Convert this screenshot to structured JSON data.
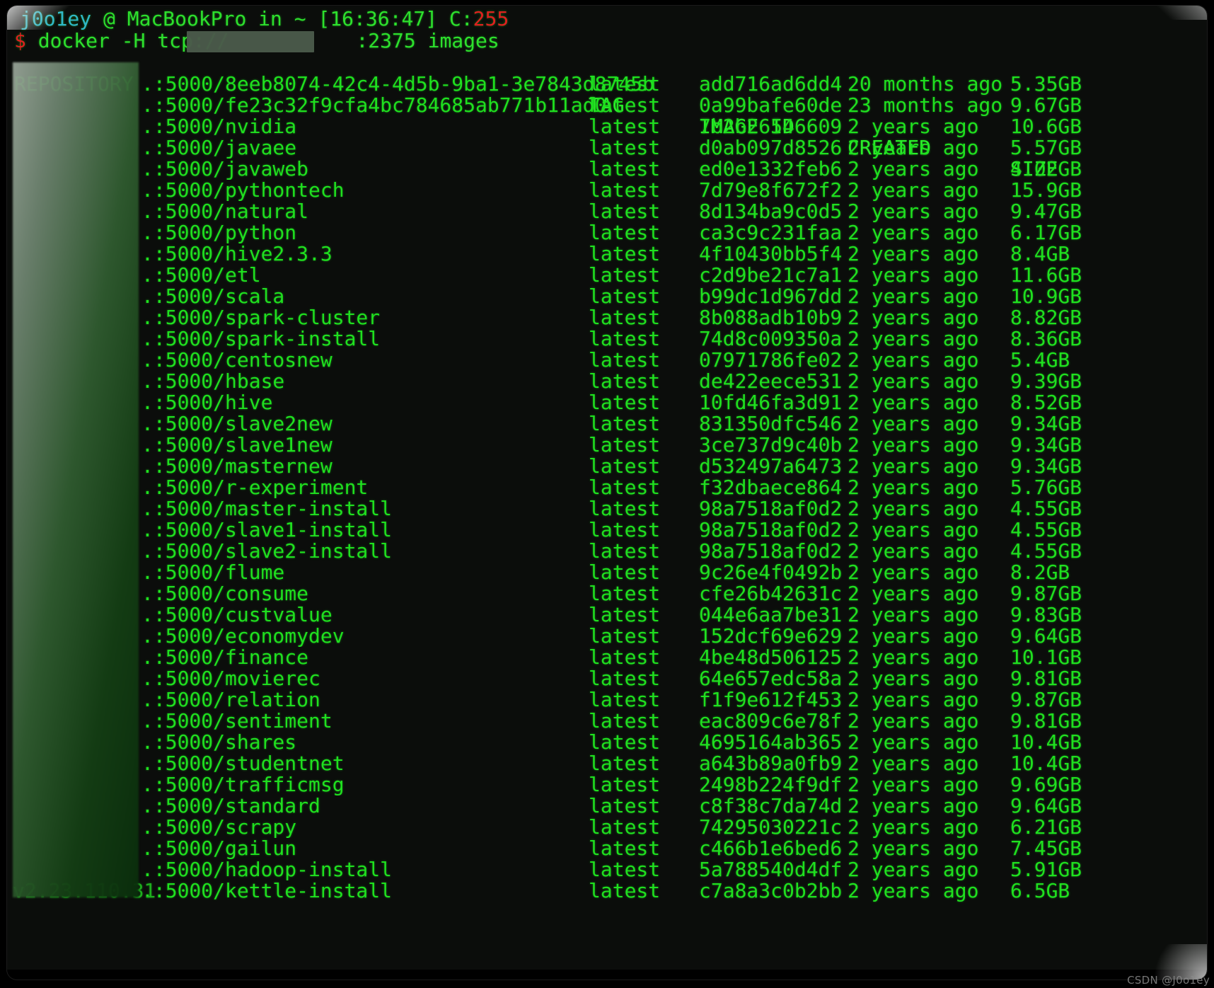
{
  "terminal": {
    "prompt": {
      "user": "j0o1ey",
      "at": "@",
      "host": "MacBookPro",
      "in": "in",
      "path": "~",
      "time_open": "[",
      "time": "16:36:47",
      "time_close": "]",
      "code_label": "C:",
      "code_value": "255"
    },
    "command": {
      "sigil": "$",
      "prefix": "docker -H tcp://",
      "redacted_host": "",
      "suffix": ":2375 images"
    },
    "headers": {
      "repository": "REPOSITORY",
      "tag": "TAG",
      "image_id": "IMAGE ID",
      "created": "CREATED",
      "size": "SIZE"
    },
    "redacted_prefix": ".",
    "last_row_visible_ip": "v2.23.110.31",
    "rows": [
      {
        "repository": ".:5000/8eeb8074-42c4-4d5b-9ba1-3e7843d8745b",
        "tag": "latest",
        "image_id": "add716ad6dd4",
        "created": "20 months ago",
        "size": "5.35GB"
      },
      {
        "repository": ".:5000/fe23c32f9cfa4bc784685ab771b11ad0",
        "tag": "latest",
        "image_id": "0a99bafe60de",
        "created": "23 months ago",
        "size": "9.67GB"
      },
      {
        "repository": ".:5000/nvidia",
        "tag": "latest",
        "image_id": "7b2b26546609",
        "created": "2 years ago",
        "size": "10.6GB"
      },
      {
        "repository": ".:5000/javaee",
        "tag": "latest",
        "image_id": "d0ab097d8526",
        "created": "2 years ago",
        "size": "5.57GB"
      },
      {
        "repository": ".:5000/javaweb",
        "tag": "latest",
        "image_id": "ed0e1332feb6",
        "created": "2 years ago",
        "size": "4.02GB"
      },
      {
        "repository": ".:5000/pythontech",
        "tag": "latest",
        "image_id": "7d79e8f672f2",
        "created": "2 years ago",
        "size": "15.9GB"
      },
      {
        "repository": ".:5000/natural",
        "tag": "latest",
        "image_id": "8d134ba9c0d5",
        "created": "2 years ago",
        "size": "9.47GB"
      },
      {
        "repository": ".:5000/python",
        "tag": "latest",
        "image_id": "ca3c9c231faa",
        "created": "2 years ago",
        "size": "6.17GB"
      },
      {
        "repository": ".:5000/hive2.3.3",
        "tag": "latest",
        "image_id": "4f10430bb5f4",
        "created": "2 years ago",
        "size": "8.4GB"
      },
      {
        "repository": ".:5000/etl",
        "tag": "latest",
        "image_id": "c2d9be21c7a1",
        "created": "2 years ago",
        "size": "11.6GB"
      },
      {
        "repository": ".:5000/scala",
        "tag": "latest",
        "image_id": "b99dc1d967dd",
        "created": "2 years ago",
        "size": "10.9GB"
      },
      {
        "repository": ".:5000/spark-cluster",
        "tag": "latest",
        "image_id": "8b088adb10b9",
        "created": "2 years ago",
        "size": "8.82GB"
      },
      {
        "repository": ".:5000/spark-install",
        "tag": "latest",
        "image_id": "74d8c009350a",
        "created": "2 years ago",
        "size": "8.36GB"
      },
      {
        "repository": ".:5000/centosnew",
        "tag": "latest",
        "image_id": "07971786fe02",
        "created": "2 years ago",
        "size": "5.4GB"
      },
      {
        "repository": ".:5000/hbase",
        "tag": "latest",
        "image_id": "de422eece531",
        "created": "2 years ago",
        "size": "9.39GB"
      },
      {
        "repository": ".:5000/hive",
        "tag": "latest",
        "image_id": "10fd46fa3d91",
        "created": "2 years ago",
        "size": "8.52GB"
      },
      {
        "repository": ".:5000/slave2new",
        "tag": "latest",
        "image_id": "831350dfc546",
        "created": "2 years ago",
        "size": "9.34GB"
      },
      {
        "repository": ".:5000/slave1new",
        "tag": "latest",
        "image_id": "3ce737d9c40b",
        "created": "2 years ago",
        "size": "9.34GB"
      },
      {
        "repository": ".:5000/masternew",
        "tag": "latest",
        "image_id": "d532497a6473",
        "created": "2 years ago",
        "size": "9.34GB"
      },
      {
        "repository": ".:5000/r-experiment",
        "tag": "latest",
        "image_id": "f32dbaece864",
        "created": "2 years ago",
        "size": "5.76GB"
      },
      {
        "repository": ".:5000/master-install",
        "tag": "latest",
        "image_id": "98a7518af0d2",
        "created": "2 years ago",
        "size": "4.55GB"
      },
      {
        "repository": ".:5000/slave1-install",
        "tag": "latest",
        "image_id": "98a7518af0d2",
        "created": "2 years ago",
        "size": "4.55GB"
      },
      {
        "repository": ".:5000/slave2-install",
        "tag": "latest",
        "image_id": "98a7518af0d2",
        "created": "2 years ago",
        "size": "4.55GB"
      },
      {
        "repository": ".:5000/flume",
        "tag": "latest",
        "image_id": "9c26e4f0492b",
        "created": "2 years ago",
        "size": "8.2GB"
      },
      {
        "repository": ".:5000/consume",
        "tag": "latest",
        "image_id": "cfe26b42631c",
        "created": "2 years ago",
        "size": "9.87GB"
      },
      {
        "repository": ".:5000/custvalue",
        "tag": "latest",
        "image_id": "044e6aa7be31",
        "created": "2 years ago",
        "size": "9.83GB"
      },
      {
        "repository": ".:5000/economydev",
        "tag": "latest",
        "image_id": "152dcf69e629",
        "created": "2 years ago",
        "size": "9.64GB"
      },
      {
        "repository": ".:5000/finance",
        "tag": "latest",
        "image_id": "4be48d506125",
        "created": "2 years ago",
        "size": "10.1GB"
      },
      {
        "repository": ".:5000/movierec",
        "tag": "latest",
        "image_id": "64e657edc58a",
        "created": "2 years ago",
        "size": "9.81GB"
      },
      {
        "repository": ".:5000/relation",
        "tag": "latest",
        "image_id": "f1f9e612f453",
        "created": "2 years ago",
        "size": "9.87GB"
      },
      {
        "repository": ".:5000/sentiment",
        "tag": "latest",
        "image_id": "eac809c6e78f",
        "created": "2 years ago",
        "size": "9.81GB"
      },
      {
        "repository": ".:5000/shares",
        "tag": "latest",
        "image_id": "4695164ab365",
        "created": "2 years ago",
        "size": "10.4GB"
      },
      {
        "repository": ".:5000/studentnet",
        "tag": "latest",
        "image_id": "a643b89a0fb9",
        "created": "2 years ago",
        "size": "10.4GB"
      },
      {
        "repository": ".:5000/trafficmsg",
        "tag": "latest",
        "image_id": "2498b224f9df",
        "created": "2 years ago",
        "size": "9.69GB"
      },
      {
        "repository": ".:5000/standard",
        "tag": "latest",
        "image_id": "c8f38c7da74d",
        "created": "2 years ago",
        "size": "9.64GB"
      },
      {
        "repository": ".:5000/scrapy",
        "tag": "latest",
        "image_id": "74295030221c",
        "created": "2 years ago",
        "size": "6.21GB"
      },
      {
        "repository": ".:5000/gailun",
        "tag": "latest",
        "image_id": "c466b1e6bed6",
        "created": "2 years ago",
        "size": "7.45GB"
      },
      {
        "repository": ".:5000/hadoop-install",
        "tag": "latest",
        "image_id": "5a788540d4df",
        "created": "2 years ago",
        "size": "5.91GB"
      },
      {
        "repository": ".:5000/kettle-install",
        "tag": "latest",
        "image_id": "c7a8a3c0b2bb",
        "created": "2 years ago",
        "size": "6.5GB"
      }
    ]
  },
  "watermark": "CSDN @J0o1ey",
  "colors": {
    "background": "#0b0d0b",
    "green": "#1fe01f",
    "cyan": "#2fb8c8",
    "red": "#e02020"
  }
}
